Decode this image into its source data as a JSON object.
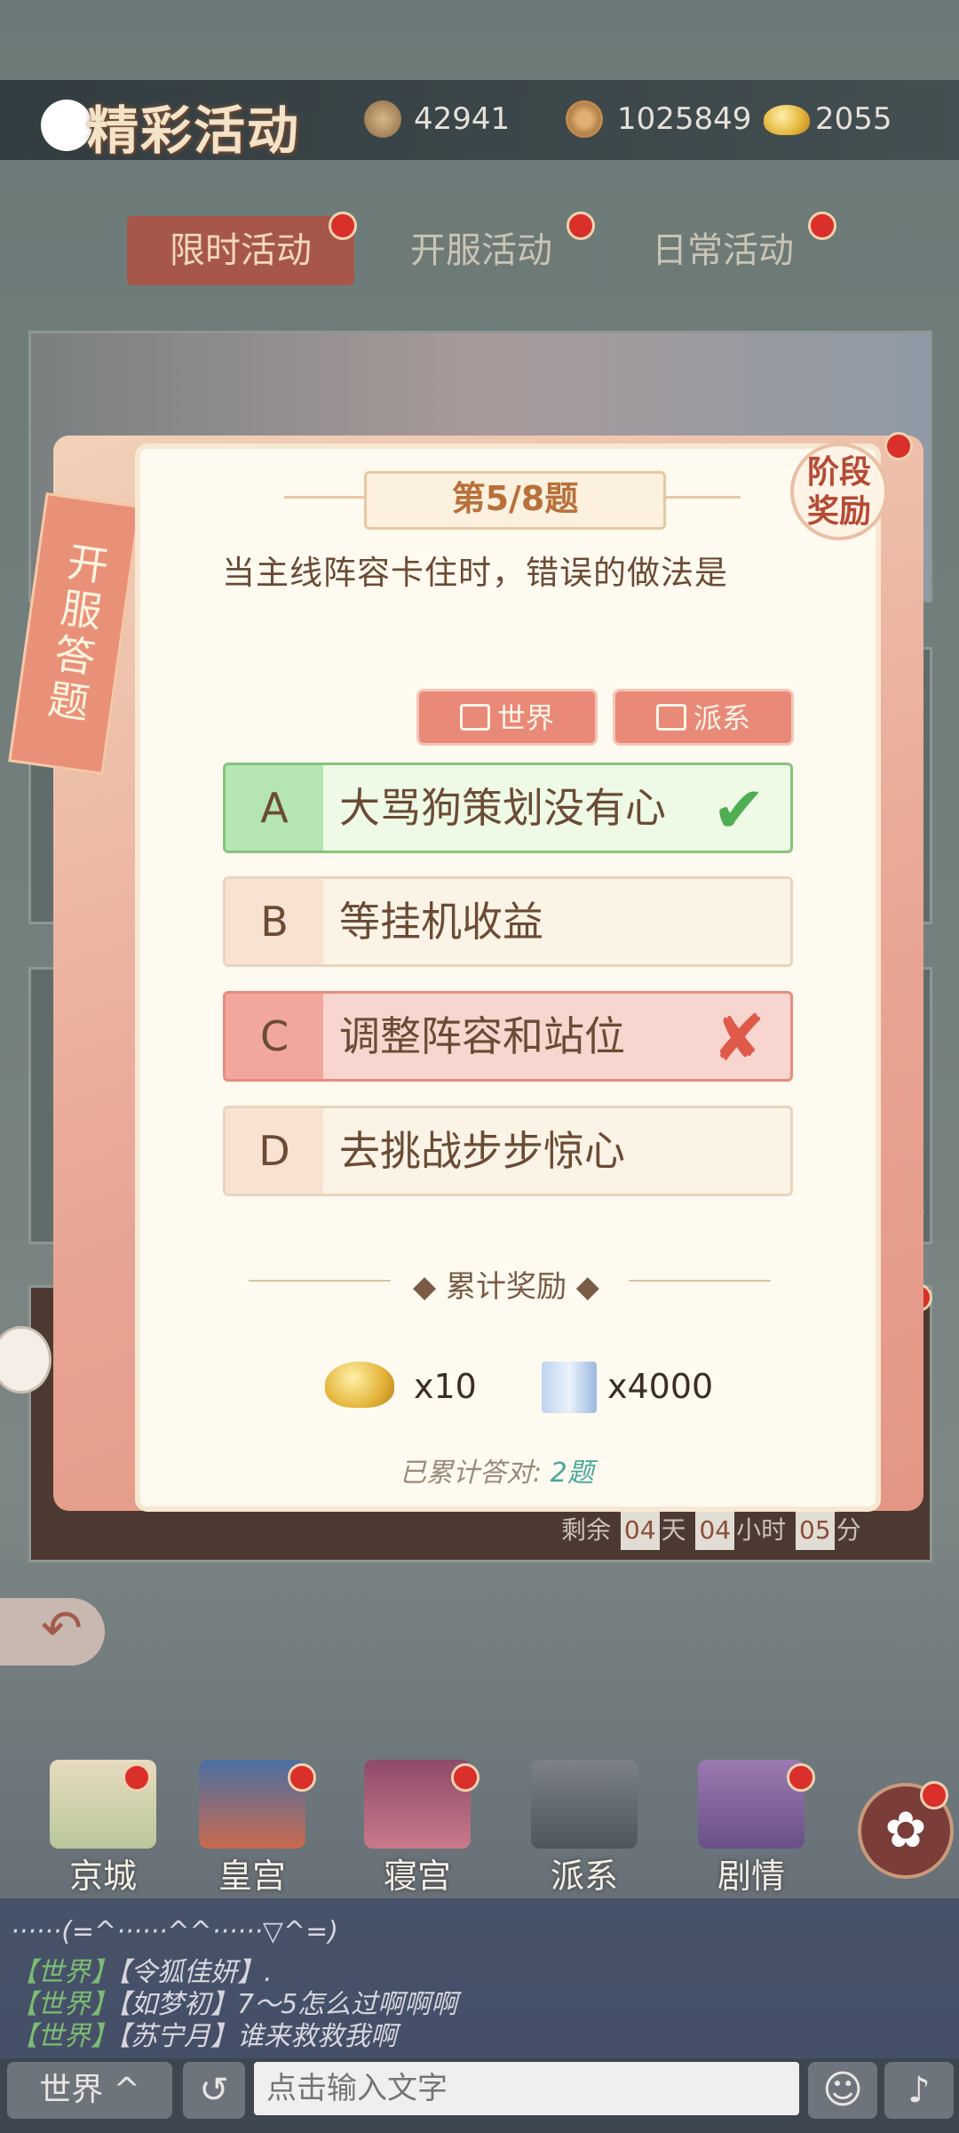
{
  "header": {
    "title": "精彩活动",
    "currencies": [
      {
        "icon": "power-icon",
        "value": "42941"
      },
      {
        "icon": "coin-icon",
        "value": "1025849"
      },
      {
        "icon": "gold-ingot-icon",
        "value": "2055"
      }
    ]
  },
  "tabs": [
    {
      "label": "限时活动",
      "active": true
    },
    {
      "label": "开服活动",
      "active": false
    },
    {
      "label": "日常活动",
      "active": false
    }
  ],
  "side": {
    "banner": "开服答题",
    "phase_reward": "阶段奖励"
  },
  "quiz": {
    "number": "第5/8题",
    "question": "当主线阵容卡住时，错误的做法是",
    "share": {
      "world": "世界",
      "faction": "派系"
    },
    "options": [
      {
        "letter": "A",
        "text": "大骂狗策划没有心",
        "state": "correct",
        "mark": "✔"
      },
      {
        "letter": "B",
        "text": "等挂机收益",
        "state": "normal",
        "mark": ""
      },
      {
        "letter": "C",
        "text": "调整阵容和站位",
        "state": "wrong",
        "mark": "✘"
      },
      {
        "letter": "D",
        "text": "去挑战步步惊心",
        "state": "normal",
        "mark": ""
      }
    ],
    "cumulative_title": "累计奖励",
    "rewards": [
      {
        "icon": "gold-ingot-icon",
        "amount": "x10"
      },
      {
        "icon": "scroll-icon",
        "amount": "x4000"
      }
    ],
    "answered_label": "已累计答对:",
    "answered_value": "2题"
  },
  "timer": {
    "prefix": "剩余",
    "days": "04",
    "days_unit": "天",
    "hours": "04",
    "hours_unit": "小时",
    "minutes": "05",
    "minutes_unit": "分"
  },
  "side_fen": [
    "分",
    "分"
  ],
  "nav": [
    {
      "label": "京城",
      "icon": "map-icon"
    },
    {
      "label": "皇宫",
      "icon": "palace-icon"
    },
    {
      "label": "寝宫",
      "icon": "bedchamber-icon"
    },
    {
      "label": "派系",
      "icon": "faction-icon"
    },
    {
      "label": "剧情",
      "icon": "story-book-icon"
    }
  ],
  "chat": {
    "lines": [
      {
        "prefix": "",
        "text": "······(=^······^^······▽^=)"
      },
      {
        "prefix": "【世界】",
        "text": "【令狐佳妍】."
      },
      {
        "prefix": "【世界】",
        "text": "【如梦初】7～5怎么过啊啊啊"
      },
      {
        "prefix": "【世界】",
        "text": "【苏宁月】谁来救救我啊"
      }
    ],
    "channel": "世界 ^",
    "input_placeholder": "点击输入文字"
  },
  "colors": {
    "accent": "#a7574a",
    "correct": "#86c47c",
    "wrong": "#e88c80"
  }
}
